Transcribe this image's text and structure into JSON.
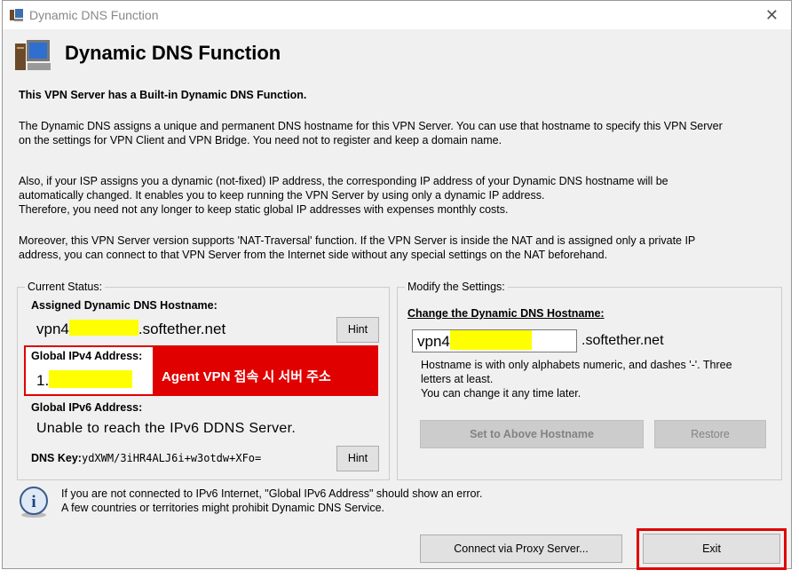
{
  "window": {
    "title": "Dynamic DNS Function",
    "close_icon": "close-icon"
  },
  "header": {
    "title": "Dynamic DNS Function"
  },
  "intro": {
    "heading": "This VPN Server has a Built-in Dynamic DNS Function.",
    "p1_l1": "The Dynamic DNS assigns a unique and permanent DNS hostname for this VPN Server. You can use that hostname to specify this VPN Server",
    "p1_l2": "on the settings for VPN Client and VPN Bridge. You need not to register and keep a domain name.",
    "p2_l1": "Also, if your ISP assigns you a dynamic (not-fixed) IP address, the corresponding IP address of your Dynamic DNS hostname will be",
    "p2_l2": "automatically changed. It enables you to keep running the VPN Server by using only a dynamic IP address.",
    "p2_l3": "Therefore, you need not any longer to keep static global IP addresses with expenses monthly costs.",
    "p3_l1": "Moreover, this VPN Server version supports 'NAT-Traversal' function. If the VPN Server is inside the NAT and is assigned only a private IP",
    "p3_l2": "address, you can connect to that VPN Server from the Internet side without any special settings on the NAT beforehand."
  },
  "status": {
    "group_label": "Current Status:",
    "hostname_label": "Assigned Dynamic DNS Hostname:",
    "hostname_prefix": "vpn4",
    "hostname_suffix": ".softether.net",
    "hint_label": "Hint",
    "ipv4_label": "Global IPv4 Address:",
    "ipv4_value": "1.",
    "annotation": "Agent VPN 접속 시 서버 주소",
    "ipv6_label": "Global IPv6 Address:",
    "ipv6_value": "Unable to reach the IPv6 DDNS Server.",
    "dnskey_label": "DNS Key:",
    "dnskey_value": "ydXWM/3iHR4ALJ6i+w3otdw+XFo=",
    "hint2_label": "Hint"
  },
  "modify": {
    "group_label": "Modify the Settings:",
    "change_label": "Change the Dynamic DNS Hostname:",
    "input_value": "vpn4",
    "suffix": ".softether.net",
    "help_l1": "Hostname is with only alphabets numeric, and dashes '-'. Three",
    "help_l2": "letters at least.",
    "help_l3": "You can change it any time later.",
    "set_button": "Set to Above Hostname",
    "restore_button": "Restore"
  },
  "info": {
    "line1": "If you are not connected to IPv6 Internet, \"Global IPv6 Address\" should show an error.",
    "line2": "A few countries or territories might prohibit Dynamic DNS Service."
  },
  "footer": {
    "proxy_button": "Connect via Proxy Server...",
    "exit_button": "Exit"
  },
  "colors": {
    "highlight": "#ffff00",
    "annotation_red": "#e00000"
  }
}
